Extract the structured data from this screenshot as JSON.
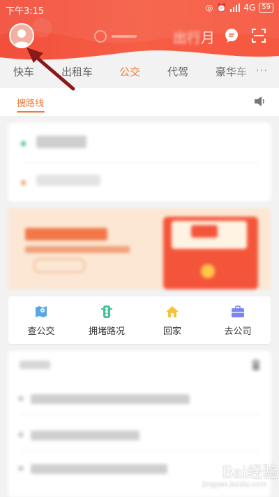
{
  "status_bar": {
    "time": "下午3:15",
    "network": "4G",
    "battery": "59"
  },
  "header": {
    "promo_text": "月",
    "colors": {
      "primary": "#f45a3e",
      "secondary": "#f8876a"
    }
  },
  "tabs": [
    {
      "label": "快车",
      "active": false
    },
    {
      "label": "出租车",
      "active": false
    },
    {
      "label": "公交",
      "active": true
    },
    {
      "label": "代驾",
      "active": false
    },
    {
      "label": "豪华车",
      "active": false
    }
  ],
  "tabs_more": "···",
  "subtab": {
    "label": "搜路线"
  },
  "accent_color": "#f07a3a",
  "quick_actions": [
    {
      "label": "查公交",
      "icon": "bus-map-icon"
    },
    {
      "label": "拥堵路况",
      "icon": "traffic-light-icon"
    },
    {
      "label": "回家",
      "icon": "home-icon"
    },
    {
      "label": "去公司",
      "icon": "briefcase-icon"
    }
  ],
  "watermark": {
    "text": "Bai经验",
    "sub": "jingyan.baidu.com"
  }
}
